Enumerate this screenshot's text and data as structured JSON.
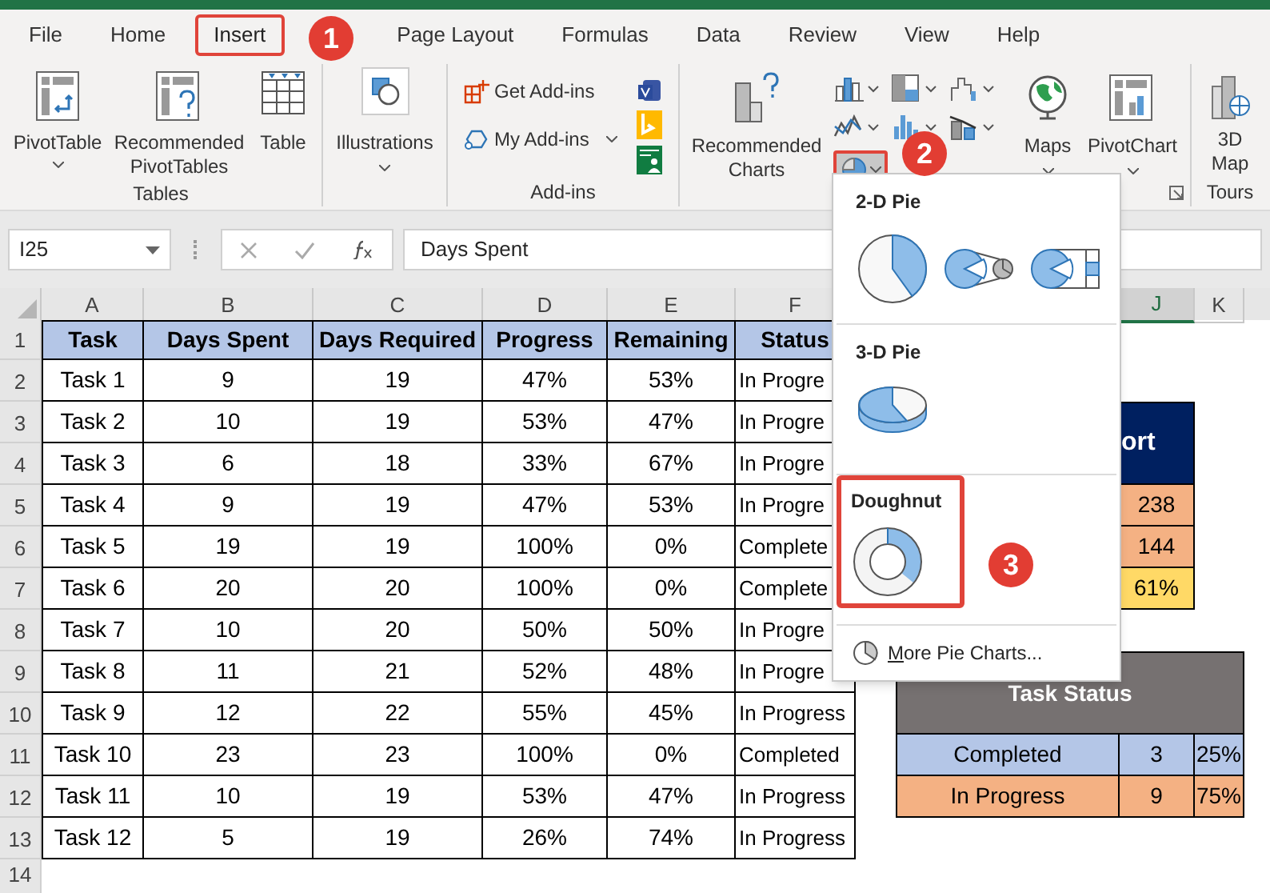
{
  "tabs": [
    {
      "label": "File",
      "selected": false
    },
    {
      "label": "Home",
      "selected": false
    },
    {
      "label": "Insert",
      "selected": true
    },
    {
      "label": "Page Layout",
      "selected": false
    },
    {
      "label": "Formulas",
      "selected": false
    },
    {
      "label": "Data",
      "selected": false
    },
    {
      "label": "Review",
      "selected": false
    },
    {
      "label": "View",
      "selected": false
    },
    {
      "label": "Help",
      "selected": false
    }
  ],
  "ribbon": {
    "tables": {
      "label": "Tables",
      "pivot_table": "PivotTable",
      "recommended_pivot_tables": "Recommended PivotTables",
      "table": "Table"
    },
    "illustrations": {
      "button": "Illustrations"
    },
    "add_ins": {
      "label": "Add-ins",
      "get_add_ins": "Get Add-ins",
      "my_add_ins": "My Add-ins"
    },
    "charts": {
      "recommended_charts": "Recommended Charts",
      "pie_button": {
        "selected": true
      },
      "maps": "Maps",
      "pivot_chart": "PivotChart"
    },
    "tours": {
      "label": "Tours",
      "map_3d": "3D Map"
    }
  },
  "formula_bar": {
    "name_box": "I25",
    "formula": "Days Spent"
  },
  "column_headers": [
    {
      "label": "A",
      "selected": false
    },
    {
      "label": "B",
      "selected": false
    },
    {
      "label": "C",
      "selected": false
    },
    {
      "label": "D",
      "selected": false
    },
    {
      "label": "E",
      "selected": false
    },
    {
      "label": "F",
      "selected": false
    },
    {
      "label": "J",
      "selected": true
    },
    {
      "label": "K",
      "selected": false
    }
  ],
  "row_numbers": [
    "1",
    "2",
    "3",
    "4",
    "5",
    "6",
    "7",
    "8",
    "9",
    "10",
    "11",
    "12",
    "13",
    "14"
  ],
  "task_table": {
    "columns": [
      "Task",
      "Days Spent",
      "Days Required",
      "Progress",
      "Remaining",
      "Status"
    ],
    "rows": [
      [
        "Task 1",
        "9",
        "19",
        "47%",
        "53%",
        "In Progre"
      ],
      [
        "Task 2",
        "10",
        "19",
        "53%",
        "47%",
        "In Progre"
      ],
      [
        "Task 3",
        "6",
        "18",
        "33%",
        "67%",
        "In Progre"
      ],
      [
        "Task 4",
        "9",
        "19",
        "47%",
        "53%",
        "In Progre"
      ],
      [
        "Task 5",
        "19",
        "19",
        "100%",
        "0%",
        "Complete"
      ],
      [
        "Task 6",
        "20",
        "20",
        "100%",
        "0%",
        "Complete"
      ],
      [
        "Task 7",
        "10",
        "20",
        "50%",
        "50%",
        "In Progre"
      ],
      [
        "Task 8",
        "11",
        "21",
        "52%",
        "48%",
        "In Progre"
      ],
      [
        "Task 9",
        "12",
        "22",
        "55%",
        "45%",
        "In Progress"
      ],
      [
        "Task 10",
        "23",
        "23",
        "100%",
        "0%",
        "Completed"
      ],
      [
        "Task 11",
        "10",
        "19",
        "53%",
        "47%",
        "In Progress"
      ],
      [
        "Task 12",
        "5",
        "19",
        "26%",
        "74%",
        "In Progress"
      ]
    ]
  },
  "report_block": {
    "header": "ort",
    "rows": [
      {
        "value": "238",
        "color": "#f4b183"
      },
      {
        "value": "144",
        "color": "#f4b183"
      },
      {
        "value": "61%",
        "color": "#ffd966"
      }
    ]
  },
  "task_status": {
    "title": "Task Status",
    "rows": [
      {
        "label": "Completed",
        "count": "3",
        "share": "25%",
        "color": "#b4c6e7"
      },
      {
        "label": "In Progress",
        "count": "9",
        "share": "75%",
        "color": "#f4b183"
      }
    ]
  },
  "pie_menu": {
    "sections": [
      {
        "title": "2-D Pie",
        "highlighted": false
      },
      {
        "title": "3-D Pie",
        "highlighted": false
      },
      {
        "title": "Doughnut",
        "highlighted": true
      }
    ],
    "more": "More Pie Charts..."
  },
  "steps": [
    "1",
    "2",
    "3"
  ]
}
